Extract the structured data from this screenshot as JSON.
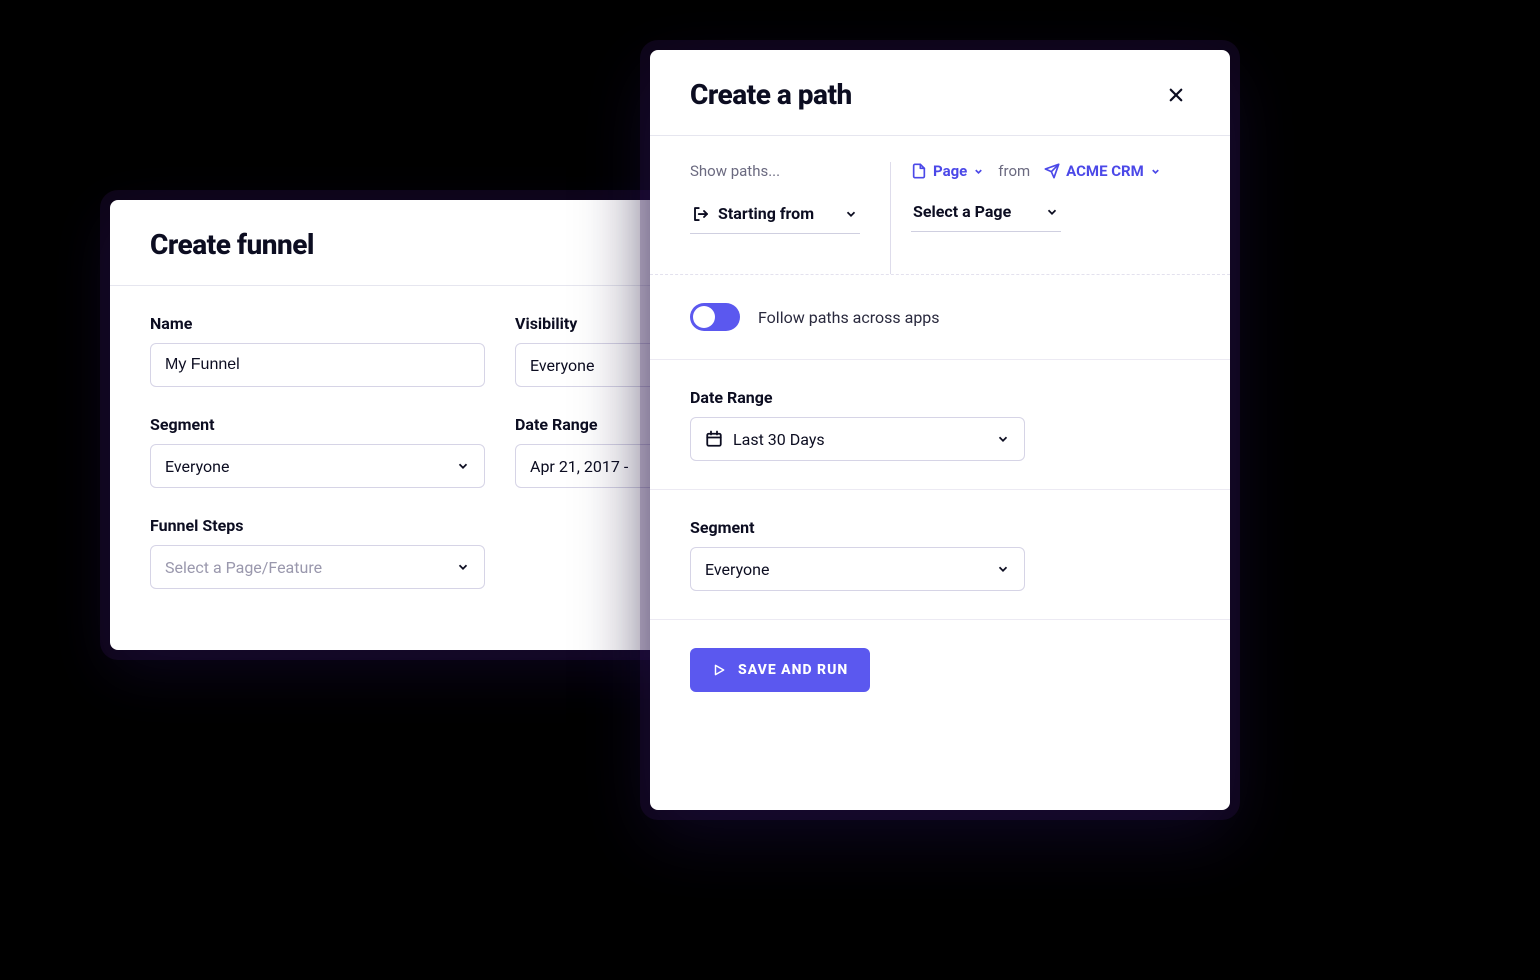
{
  "funnel": {
    "title": "Create funnel",
    "name_label": "Name",
    "name_value": "My Funnel",
    "visibility_label": "Visibility",
    "visibility_value": "Everyone",
    "segment_label": "Segment",
    "segment_value": "Everyone",
    "date_range_label": "Date Range",
    "date_range_value": "Apr 21, 2017 -",
    "steps_label": "Funnel Steps",
    "steps_placeholder": "Select a Page/Feature"
  },
  "path": {
    "title": "Create a path",
    "show_paths_label": "Show paths...",
    "starting_from_label": "Starting from",
    "type_label": "Page",
    "from_word": "from",
    "app_label": "ACME CRM",
    "select_page_label": "Select a Page",
    "toggle_label": "Follow paths across apps",
    "toggle_on": true,
    "date_range_label": "Date Range",
    "date_range_value": "Last 30 Days",
    "segment_label": "Segment",
    "segment_value": "Everyone",
    "save_button": "SAVE AND RUN"
  }
}
